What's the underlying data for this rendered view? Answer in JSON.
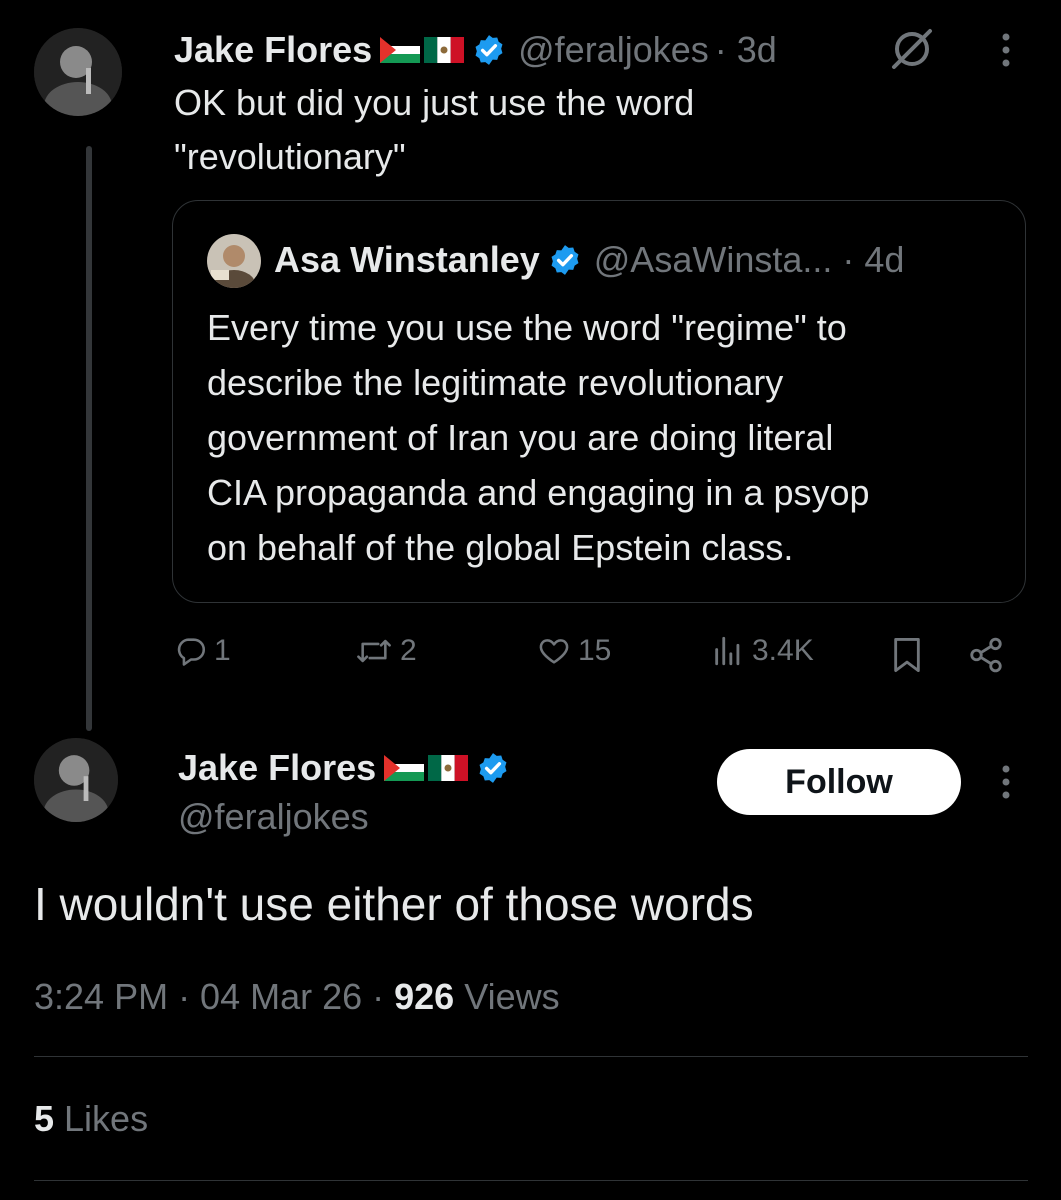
{
  "parent_tweet": {
    "author_name": "Jake Flores",
    "handle": "@feraljokes",
    "time": "· 3d",
    "text_line1": "OK but did you just use the word",
    "text_line2": "\"revolutionary\"",
    "quoted": {
      "author_name": "Asa Winstanley",
      "handle": "@AsaWinsta...",
      "time": "· 4d",
      "lines": [
        "Every time you use the word \"regime\" to",
        "describe the legitimate revolutionary",
        "government of Iran you are doing literal",
        "CIA propaganda and engaging in a psyop",
        "on behalf of the global Epstein class."
      ]
    },
    "actions": {
      "replies": "1",
      "reposts": "2",
      "likes": "15",
      "views": "3.4K"
    }
  },
  "main_tweet": {
    "author_name": "Jake Flores",
    "handle": "@feraljokes",
    "follow_label": "Follow",
    "text": "I wouldn't use either of those words",
    "meta_time": "3:24 PM · 04 Mar 26 · ",
    "meta_views_count": "926",
    "meta_views_label": " Views",
    "likes_count": "5",
    "likes_label": " Likes"
  },
  "icons": {
    "verified": "verified-badge-icon",
    "mute": "muted-icon",
    "more": "more-options-icon",
    "reply": "reply-icon",
    "repost": "repost-icon",
    "like": "heart-icon",
    "views": "views-bar-icon",
    "bookmark": "bookmark-icon",
    "share": "share-icon"
  },
  "colors": {
    "background": "#000000",
    "text": "#e7e9ea",
    "muted": "#71767b",
    "verified": "#1d9bf0",
    "border": "#2f3336"
  }
}
